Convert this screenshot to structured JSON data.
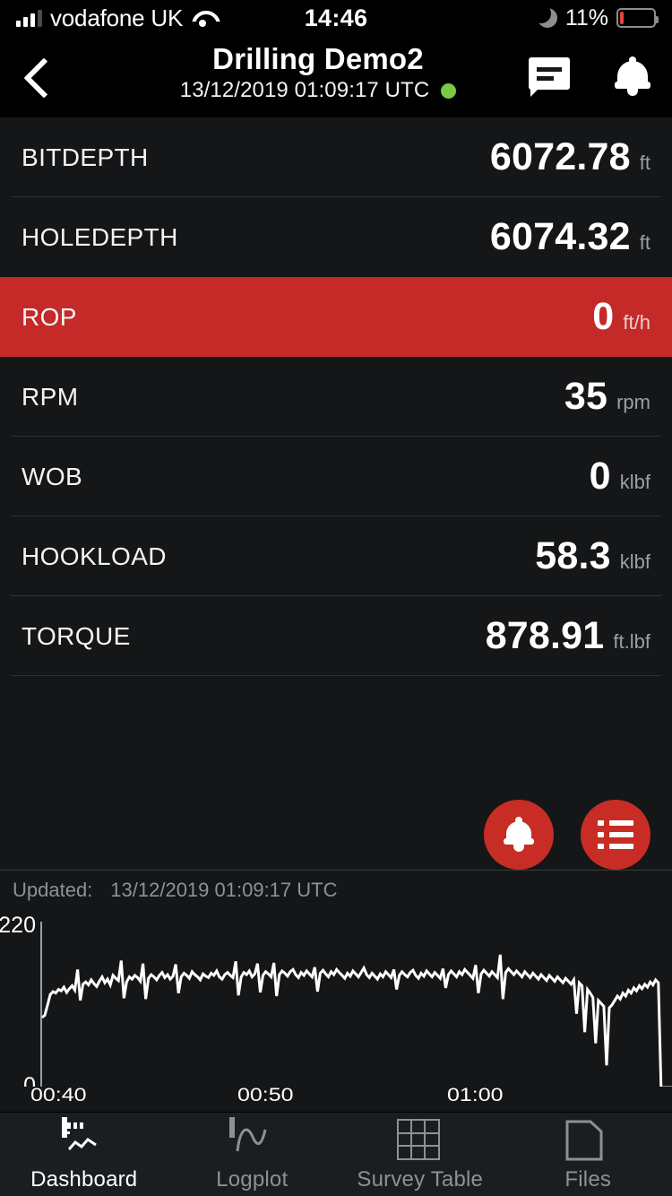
{
  "status_bar": {
    "carrier": "vodafone UK",
    "time": "14:46",
    "battery_percent": "11%",
    "battery_level": 11,
    "icons": [
      "signal-bars-icon",
      "wifi-icon",
      "moon-icon",
      "battery-icon"
    ]
  },
  "header": {
    "title": "Drilling Demo2",
    "subtitle": "13/12/2019 01:09:17 UTC",
    "status_dot_color": "#7ac943",
    "back_icon": "chevron-left-icon",
    "message_icon": "message-icon",
    "bell_icon": "bell-icon"
  },
  "colors": {
    "background": "#141618",
    "alarm_red": "#c32a28",
    "fab_red": "#c72d25",
    "divider": "#2e3134",
    "muted_text": "#9ba0a4",
    "status_green": "#7ac943"
  },
  "channels": [
    {
      "label": "BITDEPTH",
      "value": "6072.78",
      "unit": "ft",
      "alarm": false
    },
    {
      "label": "HOLEDEPTH",
      "value": "6074.32",
      "unit": "ft",
      "alarm": false
    },
    {
      "label": "ROP",
      "value": "0",
      "unit": "ft/h",
      "alarm": true
    },
    {
      "label": "RPM",
      "value": "35",
      "unit": "rpm",
      "alarm": false
    },
    {
      "label": "WOB",
      "value": "0",
      "unit": "klbf",
      "alarm": false
    },
    {
      "label": "HOOKLOAD",
      "value": "58.3",
      "unit": "klbf",
      "alarm": false
    },
    {
      "label": "TORQUE",
      "value": "878.91",
      "unit": "ft.lbf",
      "alarm": false
    }
  ],
  "fabs": [
    {
      "name": "alarm-fab",
      "icon": "bell-icon"
    },
    {
      "name": "channels-fab",
      "icon": "list-icon"
    }
  ],
  "updated": {
    "label": "Updated:",
    "timestamp": "13/12/2019 01:09:17 UTC"
  },
  "chart_data": {
    "type": "line",
    "title": "",
    "xlabel": "",
    "ylabel": "",
    "ylim": [
      0,
      220
    ],
    "grid": false,
    "legend": null,
    "y_ticks": [
      "0",
      "220"
    ],
    "x_ticks": [
      "00:40",
      "00:50",
      "01:00"
    ],
    "x_tick_positions": [
      0.0,
      0.37,
      0.74
    ],
    "series": [
      {
        "name": "channel-trend",
        "color": "#ffffff",
        "values": [
          95,
          98,
          112,
          126,
          130,
          128,
          133,
          131,
          136,
          129,
          134,
          138,
          132,
          160,
          118,
          140,
          143,
          139,
          146,
          141,
          137,
          144,
          150,
          142,
          147,
          139,
          152,
          148,
          145,
          172,
          121,
          143,
          150,
          147,
          152,
          149,
          144,
          168,
          120,
          148,
          153,
          150,
          146,
          152,
          156,
          149,
          153,
          147,
          151,
          167,
          128,
          150,
          155,
          152,
          148,
          157,
          153,
          150,
          146,
          154,
          151,
          149,
          155,
          152,
          158,
          150,
          147,
          153,
          156,
          152,
          149,
          171,
          125,
          150,
          156,
          153,
          158,
          150,
          154,
          168,
          129,
          152,
          157,
          154,
          150,
          169,
          124,
          153,
          158,
          155,
          151,
          157,
          160,
          153,
          149,
          156,
          152,
          158,
          154,
          150,
          163,
          130,
          155,
          159,
          154,
          150,
          157,
          153,
          160,
          156,
          152,
          148,
          155,
          151,
          158,
          154,
          150,
          156,
          162,
          153,
          149,
          155,
          151,
          147,
          154,
          150,
          157,
          153,
          149,
          160,
          133,
          152,
          157,
          153,
          150,
          156,
          159,
          152,
          148,
          155,
          151,
          158,
          154,
          150,
          156,
          152,
          148,
          161,
          135,
          153,
          158,
          154,
          150,
          157,
          153,
          160,
          156,
          152,
          148,
          166,
          128,
          154,
          159,
          155,
          151,
          157,
          153,
          149,
          180,
          120,
          156,
          161,
          157,
          153,
          158,
          154,
          150,
          157,
          153,
          149,
          155,
          151,
          147,
          153,
          149,
          145,
          152,
          148,
          144,
          150,
          146,
          142,
          148,
          144,
          140,
          146,
          100,
          142,
          138,
          75,
          133,
          128,
          122,
          60,
          118,
          114,
          110,
          30,
          108,
          112,
          118,
          124,
          120,
          128,
          124,
          132,
          128,
          135,
          131,
          138,
          134,
          140,
          136,
          143,
          139,
          146,
          142,
          0,
          0,
          0,
          0,
          0
        ]
      }
    ]
  },
  "tabs": [
    {
      "label": "Dashboard",
      "icon": "dashboard-icon",
      "active": true
    },
    {
      "label": "Logplot",
      "icon": "logplot-icon",
      "active": false
    },
    {
      "label": "Survey Table",
      "icon": "survey-table-icon",
      "active": false
    },
    {
      "label": "Files",
      "icon": "files-icon",
      "active": false
    }
  ]
}
